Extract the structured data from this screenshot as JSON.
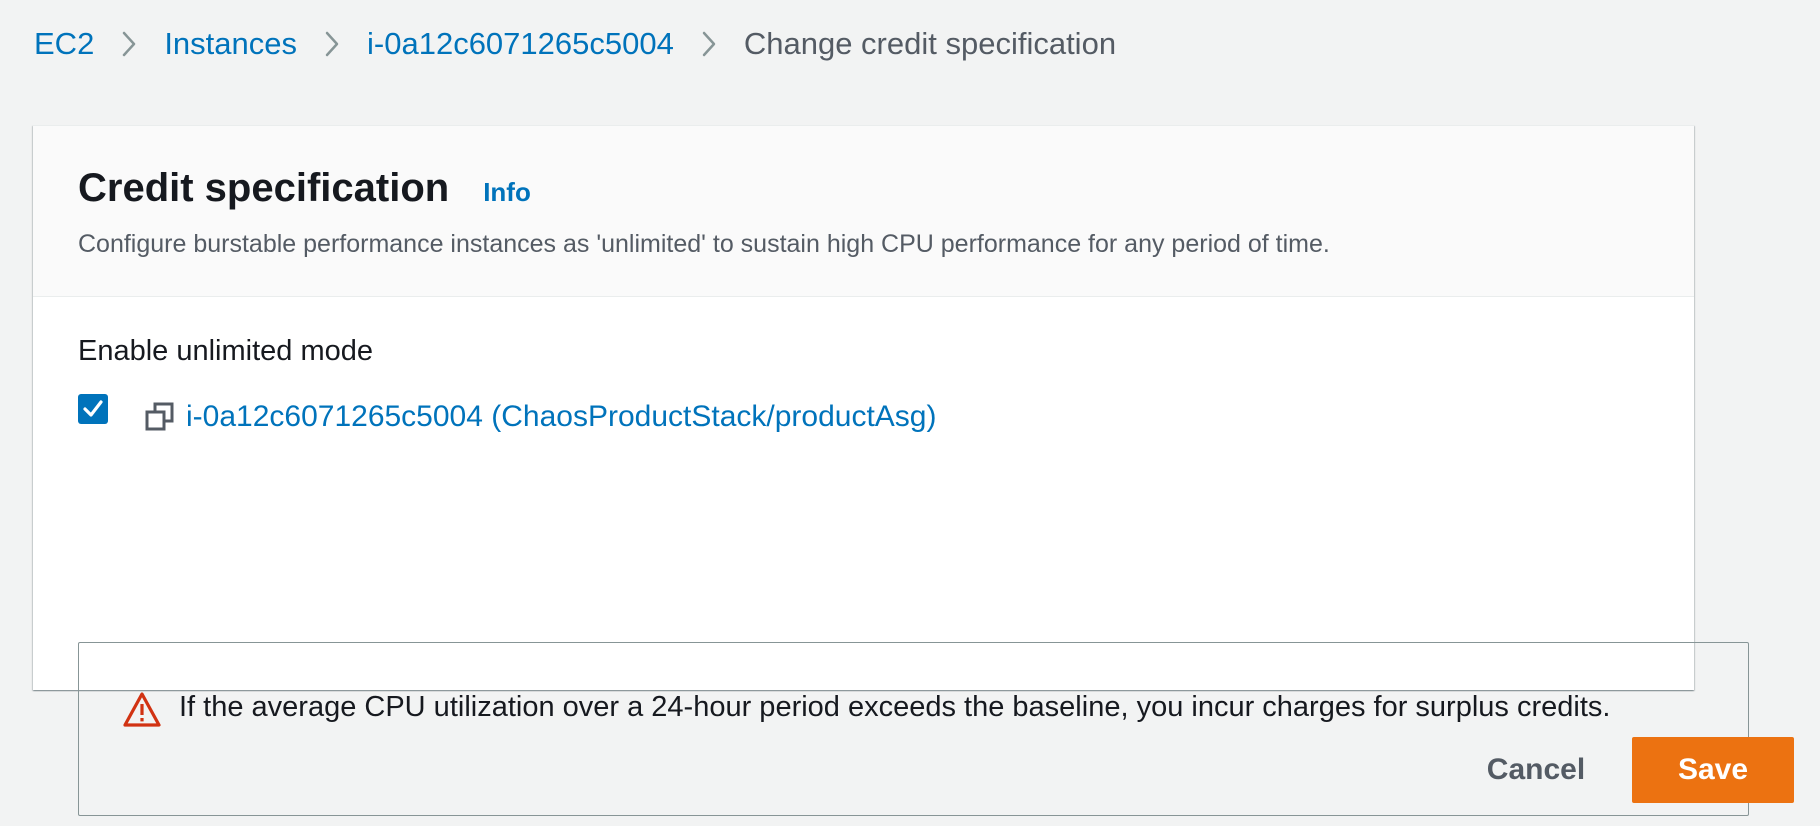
{
  "breadcrumb": {
    "items": [
      {
        "label": "EC2"
      },
      {
        "label": "Instances"
      },
      {
        "label": "i-0a12c6071265c5004"
      }
    ],
    "current": "Change credit specification"
  },
  "panel": {
    "title": "Credit specification",
    "info_label": "Info",
    "description": "Configure burstable performance instances as 'unlimited' to sustain high CPU performance for any period of time.",
    "field_label": "Enable unlimited mode",
    "checkbox": {
      "checked": true,
      "instance_label": "i-0a12c6071265c5004 (ChaosProductStack/productAsg)"
    },
    "warning": {
      "text": "If the average CPU utilization over a 24-hour period exceeds the baseline, you incur charges for surplus credits."
    }
  },
  "footer": {
    "cancel_label": "Cancel",
    "save_label": "Save"
  },
  "colors": {
    "link": "#0073bb",
    "primary_button": "#ec7211",
    "warning": "#d13212",
    "background": "#f2f3f3"
  },
  "icons": [
    "chevron-right-icon",
    "copy-icon",
    "check-icon",
    "warning-triangle-icon"
  ]
}
